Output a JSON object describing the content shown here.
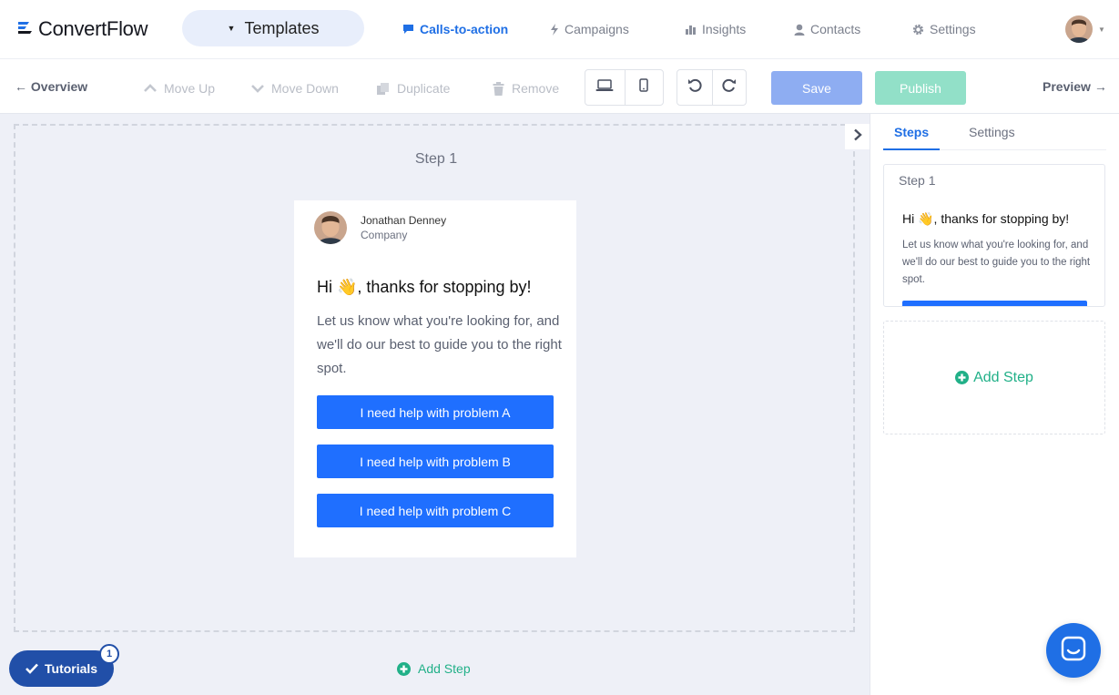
{
  "brand": {
    "name": "ConvertFlow"
  },
  "templates_menu": {
    "label": "Templates"
  },
  "nav": {
    "items": [
      {
        "label": "Calls-to-action",
        "icon": "chat-icon",
        "active": true
      },
      {
        "label": "Campaigns",
        "icon": "bolt-icon",
        "active": false
      },
      {
        "label": "Insights",
        "icon": "bar-chart-icon",
        "active": false
      },
      {
        "label": "Contacts",
        "icon": "user-icon",
        "active": false
      },
      {
        "label": "Settings",
        "icon": "gear-icon",
        "active": false
      }
    ]
  },
  "toolbar": {
    "overview": "← Overview",
    "move_up": "Move Up",
    "move_down": "Move Down",
    "duplicate": "Duplicate",
    "remove": "Remove",
    "save": "Save",
    "publish": "Publish",
    "preview": "Preview →"
  },
  "canvas": {
    "step_title": "Step 1",
    "author_name": "Jonathan Denney",
    "author_company": "Company",
    "headline": "Hi 👋, thanks for stopping by!",
    "body": "Let us know what you're looking for, and we'll do our best to guide you to the right spot.",
    "buttons": [
      "I need help with problem A",
      "I need help with problem B",
      "I need help with problem C"
    ],
    "add_step": "Add Step"
  },
  "right_panel": {
    "tabs": [
      {
        "label": "Steps",
        "active": true
      },
      {
        "label": "Settings",
        "active": false
      }
    ],
    "step_card": {
      "title": "Step 1",
      "headline": "Hi 👋, thanks for stopping by!",
      "body": "Let us know what you're looking for, and we'll do our best to guide you to the right spot."
    },
    "add_step": "Add Step"
  },
  "tutorials": {
    "label": "Tutorials",
    "badge": "1"
  },
  "colors": {
    "primary": "#1f6fe5",
    "cta_button": "#1f6fff",
    "save_disabled": "#8eadf2",
    "publish_disabled": "#92e0c8",
    "add_green": "#21b088",
    "canvas_bg": "#eef0f7",
    "tutorials_bg": "#214fa8"
  }
}
